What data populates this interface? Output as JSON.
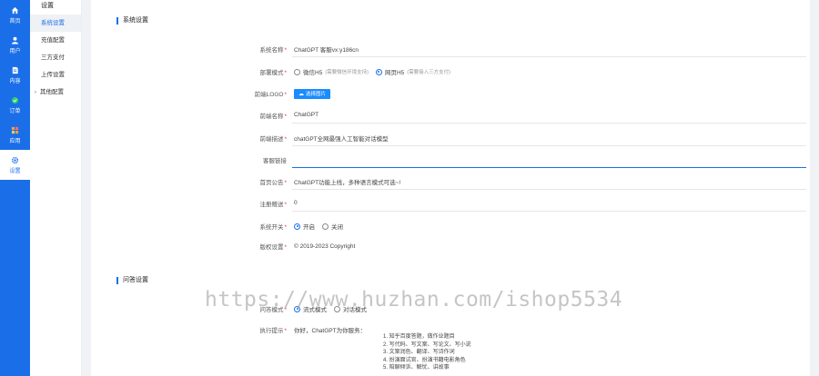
{
  "rail": [
    {
      "label": "首页",
      "icon": "home-icon"
    },
    {
      "label": "用户",
      "icon": "user-icon"
    },
    {
      "label": "内容",
      "icon": "document-icon"
    },
    {
      "label": "订单",
      "icon": "order-icon"
    },
    {
      "label": "应用",
      "icon": "apps-icon"
    },
    {
      "label": "设置",
      "icon": "gear-icon"
    }
  ],
  "submenu": {
    "title": "设置",
    "items": [
      "系统设置",
      "充值配置",
      "三方支付",
      "上传设置"
    ],
    "group": "其他配置"
  },
  "system_section": {
    "title": "系统设置",
    "site_name": {
      "label": "系统名称",
      "value": "ChatGPT 客服vx:y186cn"
    },
    "deploy_mode": {
      "label": "部署模式",
      "options": [
        {
          "label": "微信H5",
          "hint": "(需要微信环境支持)"
        },
        {
          "label": "网页H5",
          "hint": "(需要接入三方支付)"
        }
      ]
    },
    "logo": {
      "label": "前端LOGO",
      "button": "选择图片"
    },
    "frontend_name": {
      "label": "前端名称",
      "value": "ChatGPT"
    },
    "frontend_desc": {
      "label": "前端描述",
      "value": "chatGPT全网最强人工智能对话模型"
    },
    "service_link": {
      "label": "客服链接",
      "value": ""
    },
    "notice": {
      "label": "首页公告",
      "value": "ChatGPT功能上线，多种语言模式可选~!"
    },
    "register_gift": {
      "label": "注册赠送",
      "value": "0"
    },
    "site_switch": {
      "label": "系统开关",
      "on": "开启",
      "off": "关闭"
    },
    "copyright": {
      "label": "版权设置",
      "value": "© 2019-2023 Copyright"
    }
  },
  "qa_section": {
    "title": "问答设置",
    "qa_mode": {
      "label": "问答模式",
      "options": [
        "流式模式",
        "对话模式"
      ]
    },
    "prompt": {
      "label": "执行提示",
      "intro": "你好，ChatGPT为你服务：",
      "lines": [
        "1. 知乎百度答题，做作业题目",
        "2. 写代码、写文案、写论文、写小说",
        "3. 文案润色、翻译、写诗作词",
        "4. 扮演面试官、扮演书籍电影角色",
        "5. 陪聊倾诉、解忧、讲故事"
      ]
    }
  },
  "watermark": "https://www.huzhan.com/ishop5534",
  "colors": {
    "accent": "#1a6fe8",
    "required": "#e53935"
  }
}
